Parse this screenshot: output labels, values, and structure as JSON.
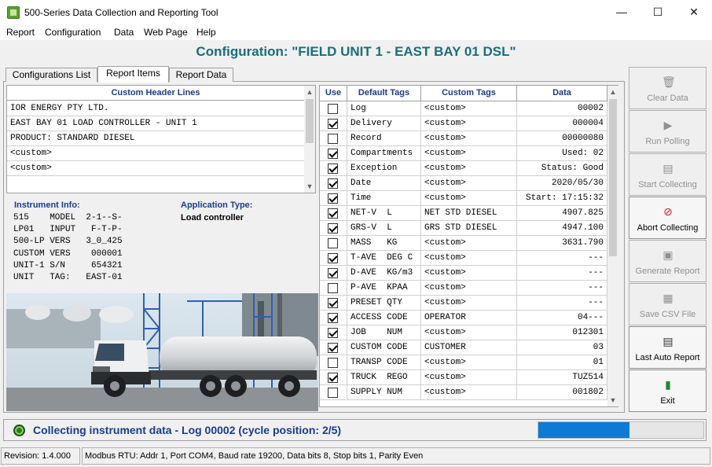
{
  "window": {
    "title": "500-Series Data Collection and Reporting Tool",
    "minimize_glyph": "—",
    "maximize_glyph": "☐",
    "close_glyph": "✕"
  },
  "menu": [
    "Report",
    "Configuration",
    "Data",
    "Web Page",
    "Help"
  ],
  "configuration_title": "Configuration: \"FIELD UNIT 1 - EAST BAY 01 DSL\"",
  "tabs": [
    "Configurations List",
    "Report Items",
    "Report Data"
  ],
  "active_tab": "Report Items",
  "header_lines": {
    "title": "Custom Header Lines",
    "rows": [
      "IOR ENERGY PTY LTD.",
      "EAST BAY 01 LOAD CONTROLLER - UNIT 1",
      "PRODUCT: STANDARD DIESEL",
      "<custom>",
      "<custom>"
    ]
  },
  "instrument_info": {
    "label": "Instrument Info:",
    "text": "515    MODEL  2-1--S-\nLP01   INPUT   F-T-P-\n500-LP VERS   3_0_425\nCUSTOM VERS    000001\nUNIT-1 S/N     654321\nUNIT   TAG:   EAST-01"
  },
  "application_type": {
    "label": "Application Type:",
    "value": "Load controller"
  },
  "tags_table": {
    "columns": [
      "Use",
      "Default Tags",
      "Custom Tags",
      "Data"
    ],
    "rows": [
      {
        "use": false,
        "default": "Log",
        "custom": "<custom>",
        "data": "00002"
      },
      {
        "use": true,
        "default": "Delivery",
        "custom": "<custom>",
        "data": "000004"
      },
      {
        "use": false,
        "default": "Record",
        "custom": "<custom>",
        "data": "00000080"
      },
      {
        "use": true,
        "default": "Compartments",
        "custom": "<custom>",
        "data": "Used: 02"
      },
      {
        "use": true,
        "default": "Exception",
        "custom": "<custom>",
        "data": "Status: Good"
      },
      {
        "use": true,
        "default": "Date",
        "custom": "<custom>",
        "data": "2020/05/30"
      },
      {
        "use": true,
        "default": "Time",
        "custom": "<custom>",
        "data": "Start: 17:15:32"
      },
      {
        "use": true,
        "default": "NET-V  L",
        "custom": "NET STD DIESEL",
        "data": "4907.825"
      },
      {
        "use": true,
        "default": "GRS-V  L",
        "custom": "GRS STD DIESEL",
        "data": "4947.100"
      },
      {
        "use": false,
        "default": "MASS   KG",
        "custom": "<custom>",
        "data": "3631.790"
      },
      {
        "use": true,
        "default": "T-AVE  DEG C",
        "custom": "<custom>",
        "data": "---"
      },
      {
        "use": true,
        "default": "D-AVE  KG/m3",
        "custom": "<custom>",
        "data": "---"
      },
      {
        "use": false,
        "default": "P-AVE  KPAA",
        "custom": "<custom>",
        "data": "---"
      },
      {
        "use": true,
        "default": "PRESET QTY",
        "custom": "<custom>",
        "data": "---"
      },
      {
        "use": true,
        "default": "ACCESS CODE",
        "custom": "OPERATOR",
        "data": "04---"
      },
      {
        "use": true,
        "default": "JOB    NUM",
        "custom": "<custom>",
        "data": "012301"
      },
      {
        "use": true,
        "default": "CUSTOM CODE",
        "custom": "CUSTOMER",
        "data": "03"
      },
      {
        "use": false,
        "default": "TRANSP CODE",
        "custom": "<custom>",
        "data": "01"
      },
      {
        "use": true,
        "default": "TRUCK  REGO",
        "custom": "<custom>",
        "data": "TUZ514"
      },
      {
        "use": false,
        "default": "SUPPLY NUM",
        "custom": "<custom>",
        "data": "001802"
      }
    ]
  },
  "side_buttons": [
    {
      "label": "Clear Data",
      "icon": "trash-icon",
      "glyph": "🗑",
      "enabled": false
    },
    {
      "label": "Run Polling",
      "icon": "play-icon",
      "glyph": "▶",
      "enabled": false
    },
    {
      "label": "Start Collecting",
      "icon": "document-icon",
      "glyph": "▤",
      "enabled": false
    },
    {
      "label": "Abort Collecting",
      "icon": "stop-icon",
      "glyph": "⊘",
      "enabled": true
    },
    {
      "label": "Generate Report",
      "icon": "report-icon",
      "glyph": "▣",
      "enabled": false
    },
    {
      "label": "Save CSV File",
      "icon": "spreadsheet-icon",
      "glyph": "▦",
      "enabled": false
    },
    {
      "label": "Last Auto Report",
      "icon": "report-icon",
      "glyph": "▤",
      "enabled": true
    },
    {
      "label": "Exit",
      "icon": "exit-door-icon",
      "glyph": "▮",
      "enabled": true
    }
  ],
  "status": {
    "text": "Collecting instrument data - Log 00002 (cycle position: 2/5)",
    "progress": 0.55
  },
  "statusbar": {
    "revision": "Revision: 1.4.000",
    "connection": "Modbus RTU: Addr 1, Port COM4, Baud rate 19200, Data bits 8, Stop bits 1, Parity Even"
  },
  "colors": {
    "accent": "#1a3c8c",
    "title_teal": "#1a6e7a",
    "progress_fill": "#0c7ad6",
    "abort_red": "#d01818",
    "exit_green": "#1f8a2e"
  }
}
